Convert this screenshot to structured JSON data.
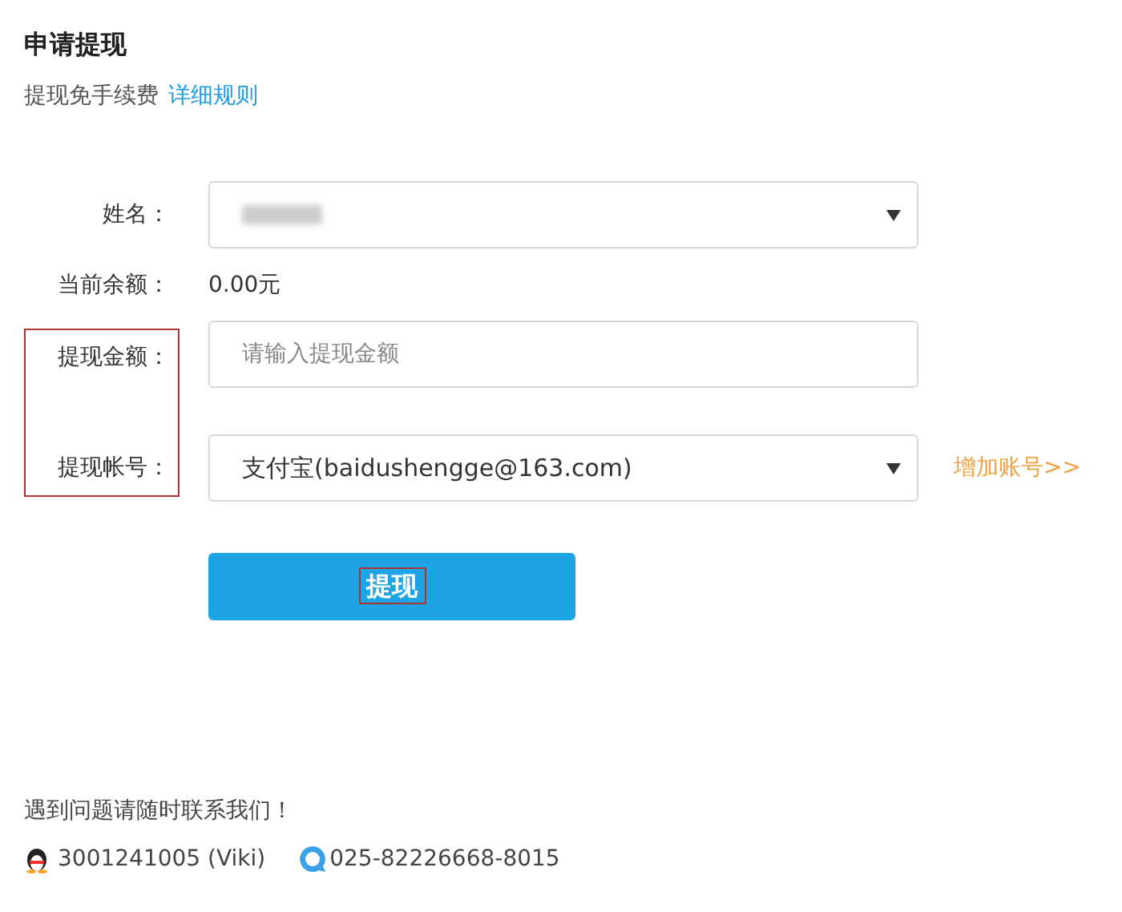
{
  "title": "申请提现",
  "subtitle": {
    "text": "提现免手续费",
    "link": "详细规则"
  },
  "rows": [
    {
      "kind": "select",
      "label": "姓名：",
      "redacted": true,
      "highlighted": false
    },
    {
      "kind": "text",
      "label": "当前余额：",
      "value": "0.00元",
      "highlighted": false
    },
    {
      "kind": "input",
      "label": "提现金额：",
      "placeholder": "请输入提现金额",
      "highlighted": true
    },
    {
      "kind": "select",
      "label": "提现帐号：",
      "value": "支付宝(baidushengge@163.com)",
      "link": "增加账号>>",
      "highlighted": true
    }
  ],
  "submit": {
    "label": "提现",
    "highlighted": true
  },
  "contact": {
    "note": "遇到问题请随时联系我们！",
    "qq": "3001241005 (Viki)",
    "phone": "025-82226668-8015"
  }
}
